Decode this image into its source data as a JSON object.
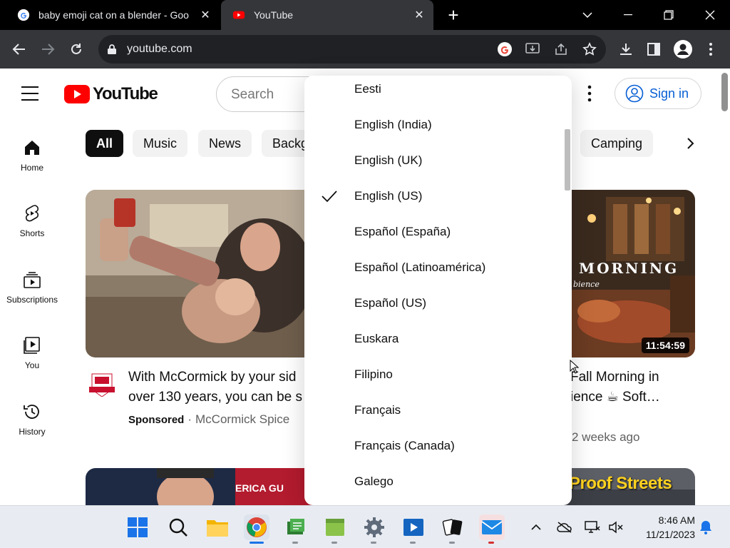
{
  "browser": {
    "tabs": [
      {
        "title": "baby emoji cat on a blender - Goo",
        "favicon": "google-g-icon",
        "close": "✕"
      },
      {
        "title": "YouTube",
        "favicon": "youtube-icon",
        "close": "✕"
      }
    ],
    "new_tab": "+",
    "address": "youtube.com"
  },
  "youtube": {
    "logo_text": "YouTube",
    "search_placeholder": "Search",
    "sign_in": "Sign in",
    "nav": [
      {
        "label": "Home",
        "icon": "home-icon"
      },
      {
        "label": "Shorts",
        "icon": "shorts-icon"
      },
      {
        "label": "Subscriptions",
        "icon": "subscriptions-icon"
      },
      {
        "label": "You",
        "icon": "you-icon"
      },
      {
        "label": "History",
        "icon": "history-icon"
      }
    ],
    "chips": [
      "All",
      "Music",
      "News",
      "Backg",
      "Camping"
    ],
    "videos": [
      {
        "title_line1": "With McCormick by your sid",
        "title_line2": "over 130 years, you can be s",
        "sponsored": "Sponsored",
        "separator": "·",
        "channel": "McCormick Spice"
      },
      {
        "title_line1": "Fall Morning in",
        "title_line2": "ience ☕ Soft…",
        "meta": "2 weeks ago",
        "duration": "11:54:59",
        "thumb_text": "MORNING",
        "thumb_sub": "bience"
      }
    ],
    "bottom_thumbs": {
      "left_text": "ERICA GU",
      "right_text": "Proof Streets"
    }
  },
  "language_menu": {
    "selected": "English (US)",
    "items": [
      "Eesti",
      "English (India)",
      "English (UK)",
      "English (US)",
      "Español (España)",
      "Español (Latinoamérica)",
      "Español (US)",
      "Euskara",
      "Filipino",
      "Français",
      "Français (Canada)",
      "Galego"
    ]
  },
  "taskbar": {
    "time": "8:46 AM",
    "date": "11/21/2023"
  }
}
